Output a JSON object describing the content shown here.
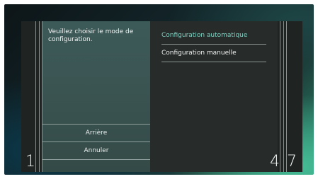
{
  "left_pane": {
    "prompt": "Veuillez choisir le mode de configuration.",
    "buttons": [
      {
        "label": "Arrière"
      },
      {
        "label": "Annuler"
      }
    ]
  },
  "menu": {
    "items": [
      {
        "label": "Configuration automatique",
        "selected": true
      },
      {
        "label": "Configuration manuelle",
        "selected": false
      }
    ]
  },
  "indicators": {
    "left_number": "1",
    "right_number_a": "4",
    "right_number_b": "7"
  },
  "colors": {
    "selected_text": "#7fd6c6",
    "panel_bg": "#262a2a",
    "left_pane_bg": "#3b5553"
  }
}
